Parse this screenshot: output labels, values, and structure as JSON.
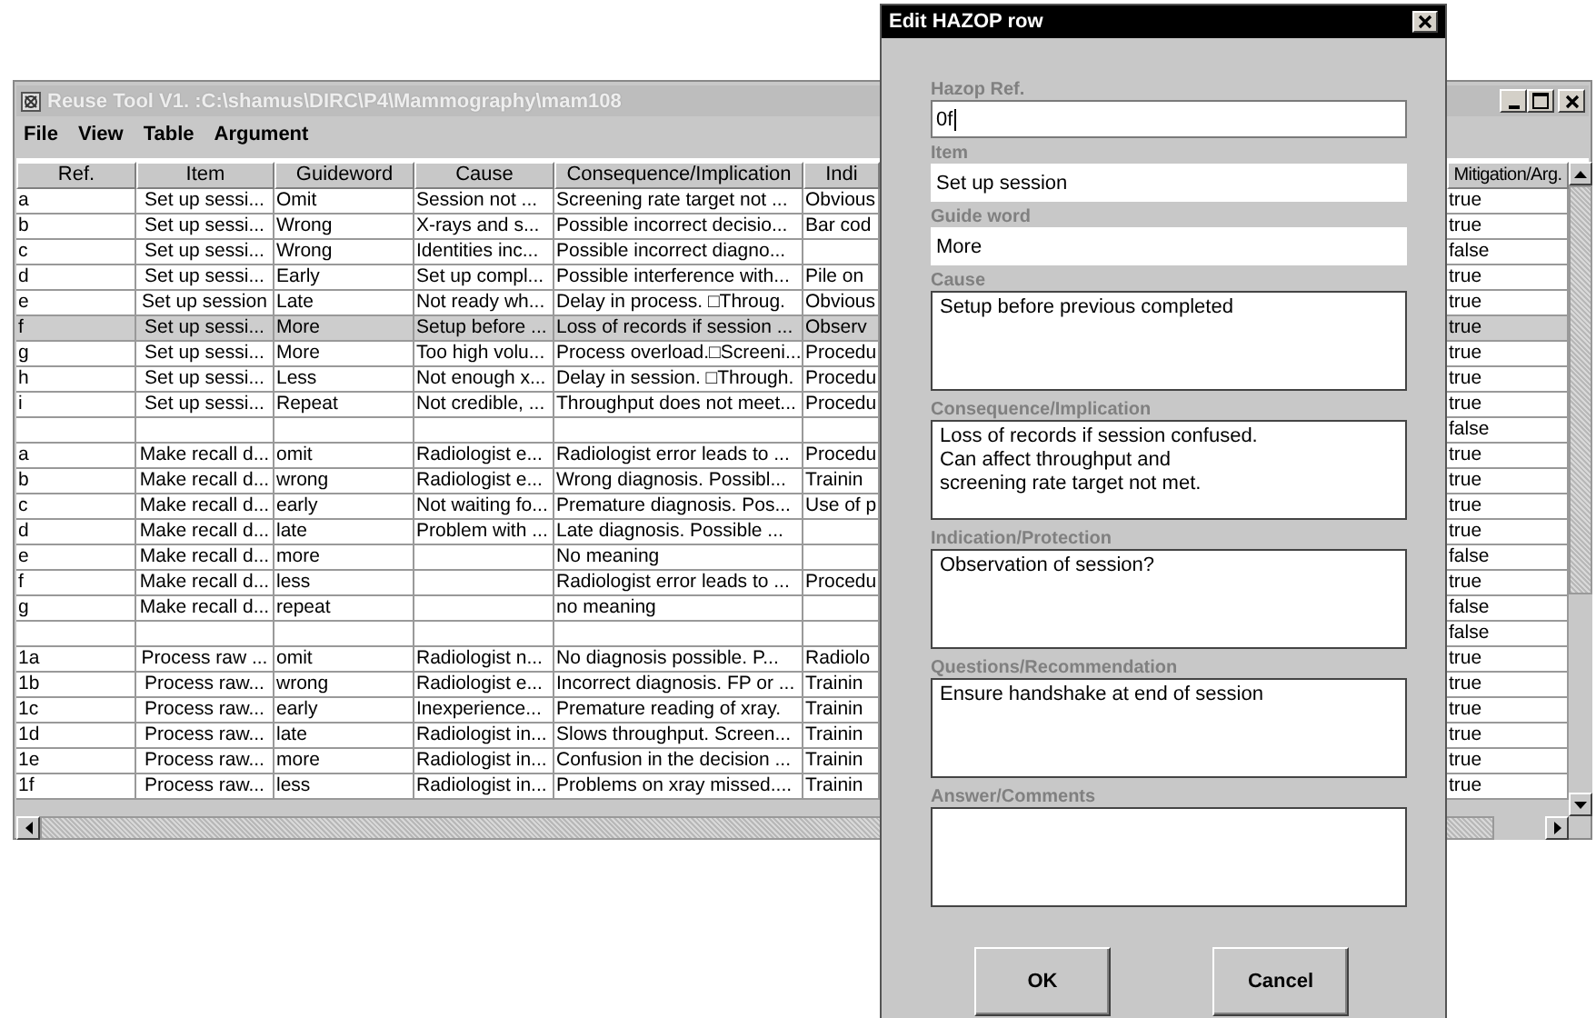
{
  "main_window": {
    "title": "Reuse Tool V1. :C:\\shamus\\DIRC\\P4\\Mammography\\mam108",
    "menu": [
      "File",
      "View",
      "Table",
      "Argument"
    ],
    "table": {
      "columns": [
        "Ref.",
        "Item",
        "Guideword",
        "Cause",
        "Consequence/Implication",
        "Indi",
        "Mitigation/Arg."
      ],
      "rows": [
        {
          "cells": [
            "a",
            "Set up sessi...",
            "Omit",
            "Session not ...",
            "Screening rate target not ...",
            "Obvious",
            "true"
          ],
          "selected": false
        },
        {
          "cells": [
            "b",
            "Set up sessi...",
            "Wrong",
            "X-rays and s...",
            "Possible incorrect decisio...",
            "Bar cod",
            "true"
          ],
          "selected": false
        },
        {
          "cells": [
            "c",
            "Set up sessi...",
            "Wrong",
            "Identities inc...",
            "Possible incorrect diagno...",
            "",
            "false"
          ],
          "selected": false
        },
        {
          "cells": [
            "d",
            "Set up sessi...",
            "Early",
            "Set up compl...",
            "Possible interference with...",
            "Pile on",
            "true"
          ],
          "selected": false
        },
        {
          "cells": [
            "e",
            "Set up session",
            "Late",
            "Not ready wh...",
            "Delay in process. □Throug.",
            "Obvious",
            "true"
          ],
          "selected": false
        },
        {
          "cells": [
            "f",
            "Set up sessi...",
            "More",
            "Setup before ...",
            "Loss of records if session ...",
            "Observ",
            "true"
          ],
          "selected": true
        },
        {
          "cells": [
            "g",
            "Set up sessi...",
            "More",
            "Too high volu...",
            "Process overload.□Screeni...",
            "Procedu",
            "true"
          ],
          "selected": false
        },
        {
          "cells": [
            "h",
            "Set up sessi...",
            "Less",
            "Not enough x...",
            "Delay in session. □Through.",
            "Procedu",
            "true"
          ],
          "selected": false
        },
        {
          "cells": [
            "i",
            "Set up sessi...",
            "Repeat",
            "Not credible, ...",
            "Throughput does not meet...",
            "Procedu",
            "true"
          ],
          "selected": false
        },
        {
          "cells": [
            "",
            "",
            "",
            "",
            "",
            "",
            "false"
          ],
          "selected": false
        },
        {
          "cells": [
            "a",
            "Make recall d...",
            "omit",
            "Radiologist e...",
            "Radiologist error leads to ...",
            "Procedu",
            "true"
          ],
          "selected": false
        },
        {
          "cells": [
            "b",
            "Make recall d...",
            "wrong",
            "Radiologist e...",
            "Wrong diagnosis. Possibl...",
            "Trainin",
            "true"
          ],
          "selected": false
        },
        {
          "cells": [
            "c",
            "Make recall d...",
            "early",
            "Not waiting fo...",
            "Premature diagnosis. Pos...",
            "Use of p",
            "true"
          ],
          "selected": false
        },
        {
          "cells": [
            "d",
            "Make recall d...",
            "late",
            "Problem with ...",
            "Late diagnosis. Possible ...",
            "",
            "true"
          ],
          "selected": false
        },
        {
          "cells": [
            "e",
            "Make recall d...",
            "more",
            "",
            "No meaning",
            "",
            "false"
          ],
          "selected": false
        },
        {
          "cells": [
            "f",
            "Make recall d...",
            "less",
            "",
            "Radiologist error leads to ...",
            "Procedu",
            "true"
          ],
          "selected": false
        },
        {
          "cells": [
            "g",
            "Make recall d...",
            "repeat",
            "",
            "no meaning",
            "",
            "false"
          ],
          "selected": false
        },
        {
          "cells": [
            "",
            "",
            "",
            "",
            "",
            "",
            "false"
          ],
          "selected": false
        },
        {
          "cells": [
            "1a",
            "Process raw ...",
            "omit",
            "Radiologist n...",
            "No diagnosis possible. P...",
            "Radiolo",
            "true"
          ],
          "selected": false
        },
        {
          "cells": [
            "1b",
            "Process raw...",
            "wrong",
            "Radiologist e...",
            "Incorrect diagnosis. FP or ...",
            "Trainin",
            "true"
          ],
          "selected": false
        },
        {
          "cells": [
            "1c",
            "Process raw...",
            "early",
            "Inexperience...",
            "Premature reading of xray.",
            "Trainin",
            "true"
          ],
          "selected": false
        },
        {
          "cells": [
            "1d",
            "Process raw...",
            "late",
            "Radiologist in...",
            "Slows throughput. Screen...",
            "Trainin",
            "true"
          ],
          "selected": false
        },
        {
          "cells": [
            "1e",
            "Process raw...",
            "more",
            "Radiologist in...",
            "Confusion in the decision ...",
            "Trainin",
            "true"
          ],
          "selected": false
        },
        {
          "cells": [
            "1f",
            "Process raw...",
            "less",
            "Radiologist in...",
            "Problems on xray missed....",
            "Trainin",
            "true"
          ],
          "selected": false
        }
      ]
    }
  },
  "dialog": {
    "title": "Edit HAZOP row",
    "fields": [
      {
        "kind": "line",
        "label": "Hazop Ref.",
        "value": "0f",
        "focused": true
      },
      {
        "kind": "line",
        "label": "Item",
        "value": "Set up session",
        "focused": false
      },
      {
        "kind": "line",
        "label": "Guide word",
        "value": "More",
        "focused": false
      },
      {
        "kind": "area",
        "label": "Cause",
        "value": "Setup before previous completed",
        "focused": false
      },
      {
        "kind": "area",
        "label": "Consequence/Implication",
        "value": "Loss of records if session confused.\nCan affect throughput and\nscreening rate target not met.",
        "focused": false
      },
      {
        "kind": "area",
        "label": "Indication/Protection",
        "value": "Observation of session?",
        "focused": false
      },
      {
        "kind": "area",
        "label": "Questions/Recommendation",
        "value": "Ensure handshake at end of session",
        "focused": false
      },
      {
        "kind": "area",
        "label": "Answer/Comments",
        "focused": false
      }
    ],
    "buttons": [
      "OK",
      "Cancel"
    ]
  }
}
